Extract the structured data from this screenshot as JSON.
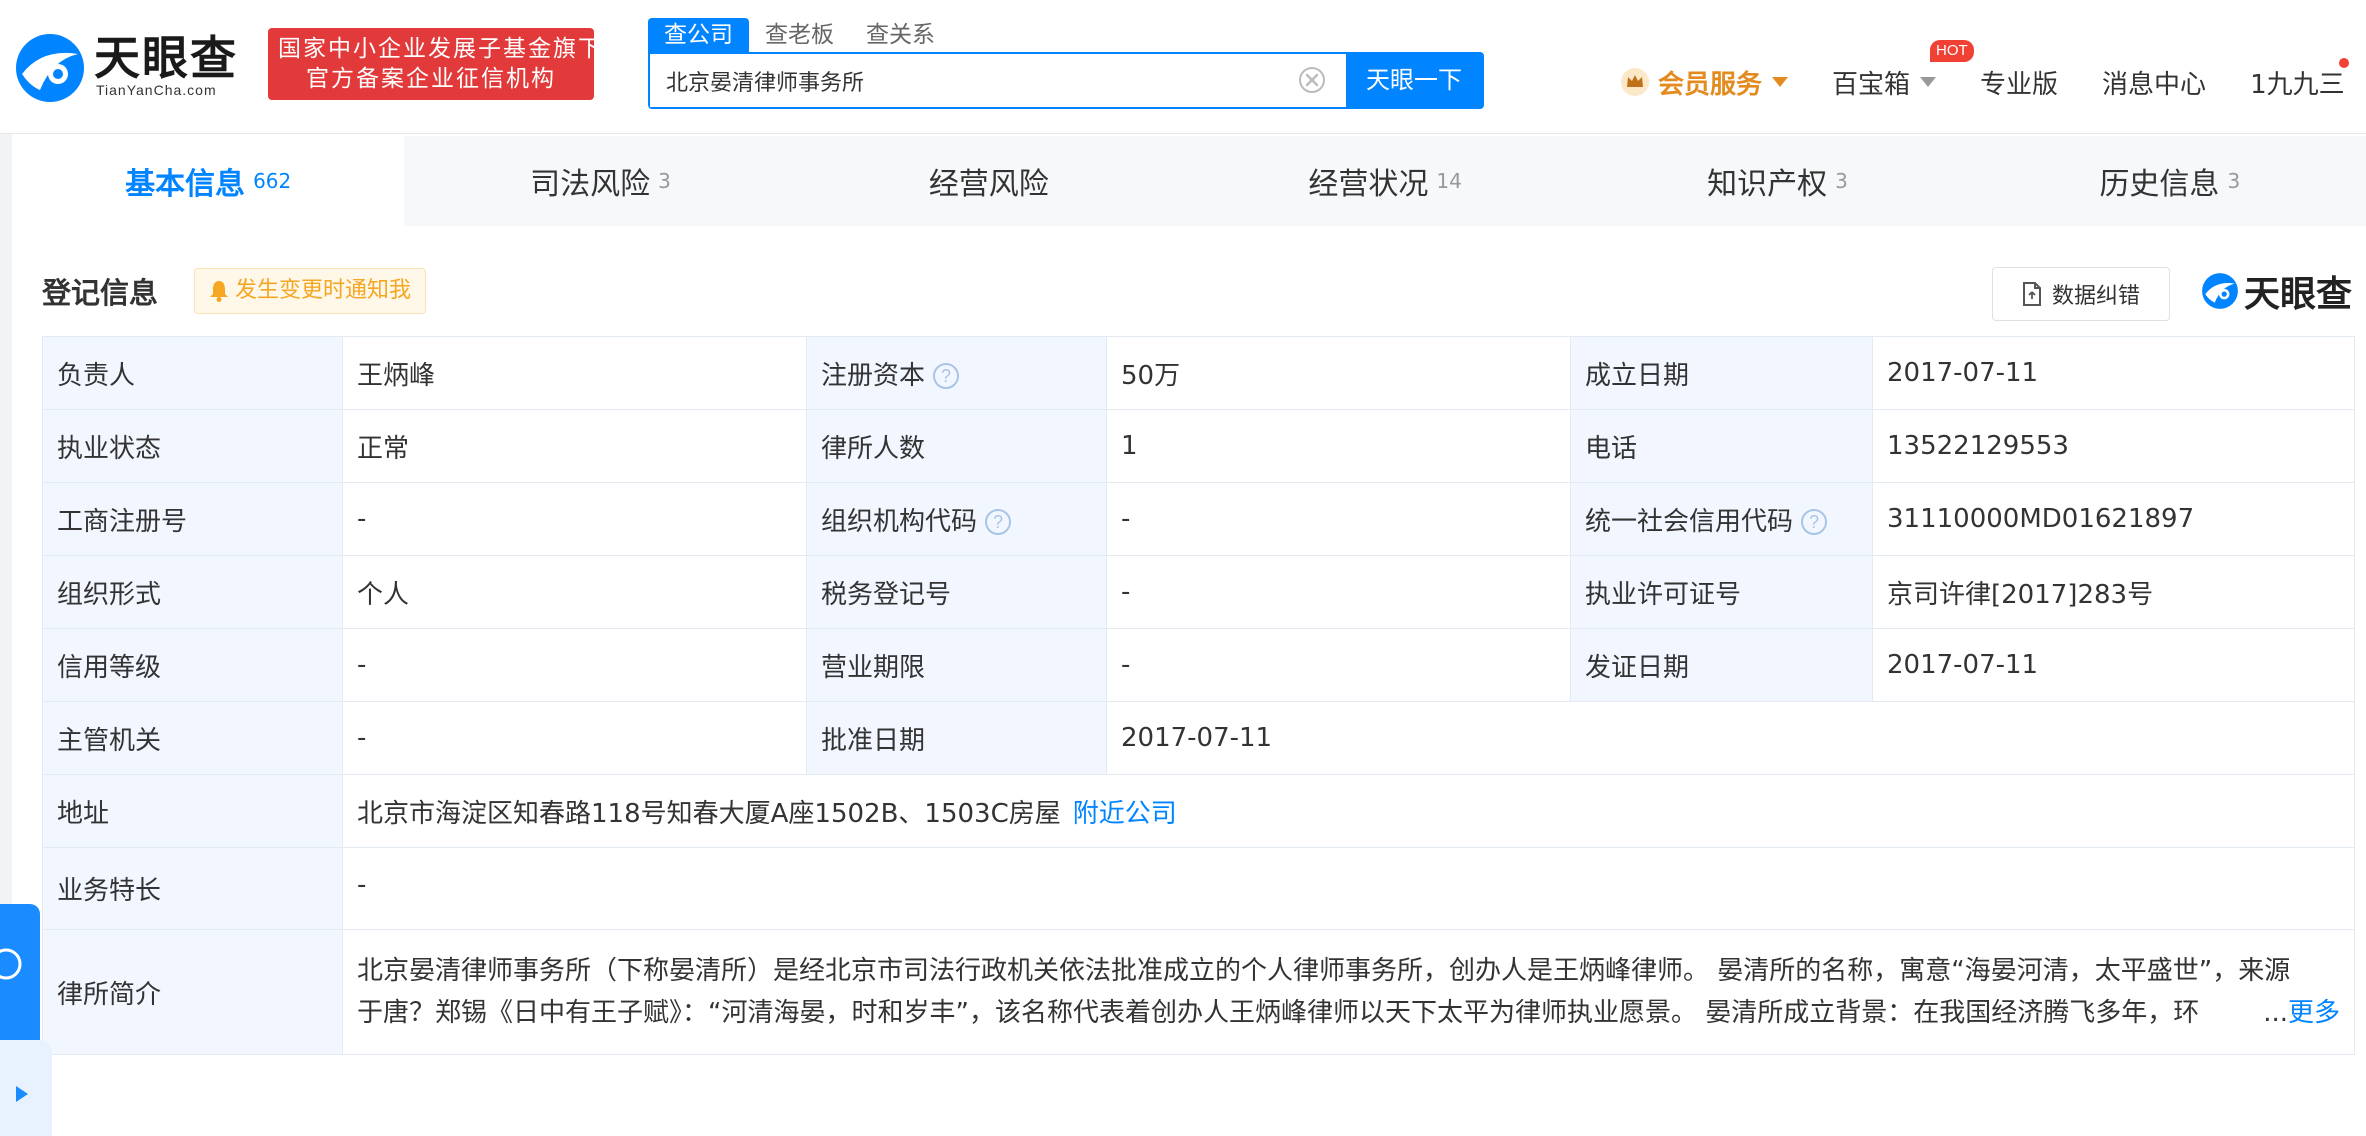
{
  "header": {
    "logo_text": "天眼查",
    "logo_sub": "TianYanCha.com",
    "gov_badge_line1": "国家中小企业发展子基金旗下",
    "gov_badge_line2": "官方备案企业征信机构",
    "search_tabs": [
      "查公司",
      "查老板",
      "查关系"
    ],
    "search_value": "北京晏清律师事务所",
    "search_button": "天眼一下",
    "nav": {
      "vip": "会员服务",
      "treasure": "百宝箱",
      "hot_badge": "HOT",
      "pro": "专业版",
      "messages": "消息中心",
      "user": "1九九三"
    }
  },
  "tabs": [
    {
      "label": "基本信息",
      "count": "662"
    },
    {
      "label": "司法风险",
      "count": "3"
    },
    {
      "label": "经营风险",
      "count": ""
    },
    {
      "label": "经营状况",
      "count": "14"
    },
    {
      "label": "知识产权",
      "count": "3"
    },
    {
      "label": "历史信息",
      "count": "3"
    }
  ],
  "section": {
    "title": "登记信息",
    "notify_label": "发生变更时通知我",
    "correction_label": "数据纠错",
    "brand_text": "天眼查"
  },
  "rows": {
    "r1": {
      "l1": "负责人",
      "v1": "王炳峰",
      "l2": "注册资本",
      "v2": "50万",
      "l3": "成立日期",
      "v3": "2017-07-11"
    },
    "r2": {
      "l1": "执业状态",
      "v1": "正常",
      "l2": "律所人数",
      "v2": "1",
      "l3": "电话",
      "v3": "13522129553"
    },
    "r3": {
      "l1": "工商注册号",
      "v1": "-",
      "l2": "组织机构代码",
      "v2": "-",
      "l3": "统一社会信用代码",
      "v3": "31110000MD01621897"
    },
    "r4": {
      "l1": "组织形式",
      "v1": "个人",
      "l2": "税务登记号",
      "v2": "-",
      "l3": "执业许可证号",
      "v3": "京司许律[2017]283号"
    },
    "r5": {
      "l1": "信用等级",
      "v1": "-",
      "l2": "营业期限",
      "v2": "-",
      "l3": "发证日期",
      "v3": "2017-07-11"
    },
    "r6": {
      "l1": "主管机关",
      "v1": "-",
      "l2": "批准日期",
      "v2": "2017-07-11"
    },
    "address": {
      "label": "地址",
      "value": "北京市海淀区知春路118号知春大厦A座1502B、1503C房屋",
      "link": "附近公司"
    },
    "specialty": {
      "label": "业务特长",
      "value": "-"
    },
    "intro": {
      "label": "律所简介",
      "line1": "北京晏清律师事务所（下称晏清所）是经北京市司法行政机关依法批准成立的个人律师事务所，创办人是王炳峰律师。 晏清所的名称，寓意“海晏河清，太平盛世”，来源",
      "line2": "于唐？郑锡《日中有王子赋》：“河清海晏，时和岁丰”，该名称代表着创办人王炳峰律师以天下太平为律师执业愿景。 晏清所成立背景：在我国经济腾飞多年，环",
      "ellipsis": "...",
      "more": "更多"
    }
  }
}
